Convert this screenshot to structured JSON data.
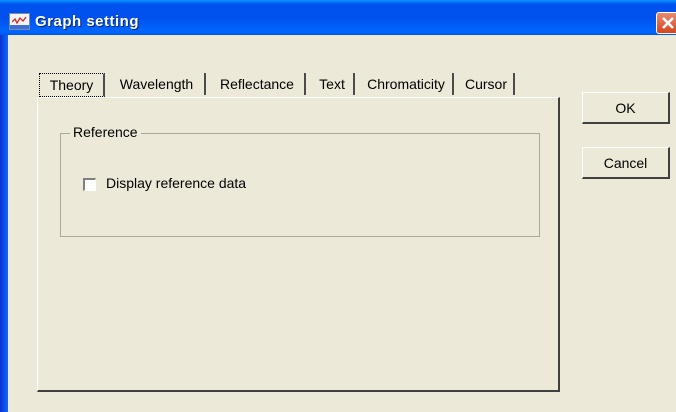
{
  "window": {
    "title": "Graph setting"
  },
  "tabs": [
    {
      "label": "Theory",
      "active": true
    },
    {
      "label": "Wavelength"
    },
    {
      "label": "Reflectance"
    },
    {
      "label": "Text"
    },
    {
      "label": "Chromaticity"
    },
    {
      "label": "Cursor"
    }
  ],
  "panel": {
    "group_label": "Reference",
    "checkbox_label": "Display reference data",
    "checkbox_checked": false
  },
  "buttons": {
    "ok": "OK",
    "cancel": "Cancel"
  },
  "icons": {
    "app": "graph-app-icon",
    "close": "close-icon"
  }
}
